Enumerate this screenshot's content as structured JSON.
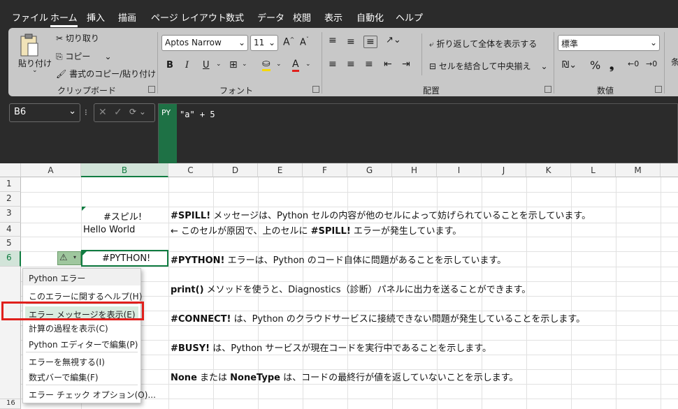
{
  "menubar": {
    "tabs": [
      "ファイル",
      "ホーム",
      "挿入",
      "描画",
      "ページ レイアウト",
      "数式",
      "データ",
      "校閲",
      "表示",
      "自動化",
      "ヘルプ"
    ],
    "active": "ホーム"
  },
  "ribbon": {
    "clipboard": {
      "paste": "貼り付け",
      "cut": "切り取り",
      "copy": "コピー",
      "format_painter": "書式のコピー/貼り付け",
      "label": "クリップボード"
    },
    "font": {
      "font_name": "Aptos Narrow",
      "font_size": "11",
      "bold": "B",
      "italic": "I",
      "underline": "U",
      "label": "フォント"
    },
    "alignment": {
      "wrap": "折り返して全体を表示する",
      "merge": "セルを結合して中央揃え",
      "label": "配置"
    },
    "number": {
      "format": "標準",
      "percent": "%",
      "comma": "❟",
      "label": "数値"
    }
  },
  "formula_bar": {
    "name_box": "B6",
    "py_badge": "PY",
    "formula": "\"a\" + 5"
  },
  "grid": {
    "columns": [
      "A",
      "B",
      "C",
      "D",
      "E",
      "F",
      "G",
      "H",
      "I",
      "J",
      "K",
      "L",
      "M"
    ],
    "rows": [
      "1",
      "2",
      "3",
      "4",
      "5",
      "6",
      "16"
    ],
    "cells": {
      "b3": "#スピル!",
      "b4": "Hello World",
      "b6": "#PYTHON!",
      "c3_bold": "#SPILL!",
      "c3_rest": " メッセージは、Python セルの内容が他のセルによって妨げられていることを示しています。",
      "c4_pre": "← このセルが原因で、上のセルに ",
      "c4_bold": "#SPILL!",
      "c4_post": " エラーが発生しています。",
      "c6_bold": "#PYTHON!",
      "c6_rest": " エラーは、Python のコード自体に問題があることを示しています。",
      "c8_bold": "print()",
      "c8_rest": " メソッドを使うと、Diagnostics（診断）パネルに出力を送ることができます。",
      "c10_bold": "#CONNECT!",
      "c10_rest": " は、Python のクラウドサービスに接続できない問題が発生していることを示します。",
      "c12_bold": "#BUSY!",
      "c12_rest": " は、Python サービスが現在コードを実行中であることを示します。",
      "c14_bold1": "None",
      "c14_mid": " または ",
      "c14_bold2": "NoneType",
      "c14_rest": " は、コードの最終行が値を返していないことを示します。"
    }
  },
  "context_menu": {
    "header": "Python エラー",
    "items": [
      "このエラーに関するヘルプ(H)",
      "エラー メッセージを表示(E)",
      "計算の過程を表示(C)",
      "Python エディターで編集(P)",
      "エラーを無視する(I)",
      "数式バーで編集(F)",
      "エラー チェック オプション(O)..."
    ],
    "highlighted_index": 1
  },
  "colors": {
    "accent": "#107c41",
    "highlight": "#e0201c",
    "ribbon_bg": "#c8c8c8",
    "chrome_bg": "#2b2b2b"
  }
}
